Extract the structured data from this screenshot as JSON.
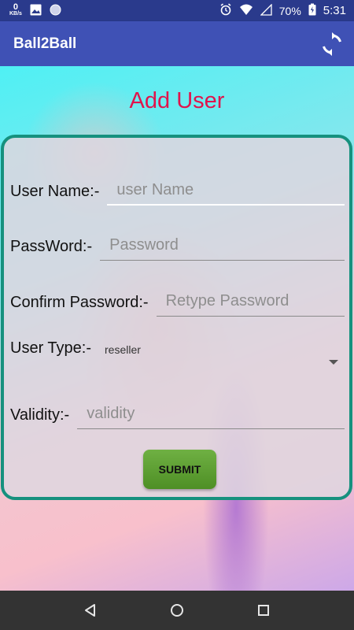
{
  "status_bar": {
    "net_speed_value": "0",
    "net_speed_unit": "KB/s",
    "battery": "70%",
    "time": "5:31"
  },
  "app_bar": {
    "title": "Ball2Ball",
    "action_icon": "refresh-icon"
  },
  "page": {
    "title": "Add User"
  },
  "form": {
    "username": {
      "label": "User Name:-",
      "placeholder": "user Name",
      "value": ""
    },
    "password": {
      "label": "PassWord:-",
      "placeholder": "Password",
      "value": ""
    },
    "confirm_password": {
      "label": "Confirm Password:-",
      "placeholder": "Retype Password",
      "value": ""
    },
    "user_type": {
      "label": "User Type:-",
      "selected": "reseller"
    },
    "validity": {
      "label": "Validity:-",
      "placeholder": "validity",
      "value": ""
    },
    "submit_label": "SUBMIT"
  },
  "colors": {
    "app_bar": "#3f51b5",
    "status_bar": "#2a3a8c",
    "title": "#e0144c",
    "card_border": "#16917e",
    "submit": "#5a9e30"
  }
}
